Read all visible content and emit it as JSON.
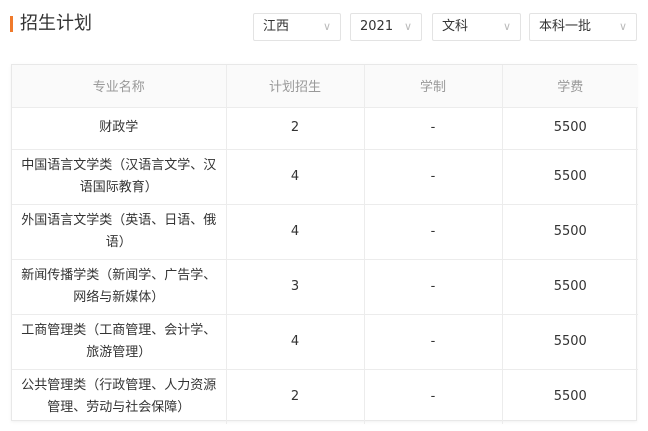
{
  "header": {
    "title": "招生计划"
  },
  "filters": {
    "province": "江西",
    "year": "2021",
    "subject": "文科",
    "batch": "本科一批",
    "chevron": "∨"
  },
  "table": {
    "columns": [
      "专业名称",
      "计划招生",
      "学制",
      "学费"
    ],
    "rows": [
      {
        "major": "财政学",
        "plan": "2",
        "duration": "-",
        "fee": "5500"
      },
      {
        "major": "中国语言文学类（汉语言文学、汉语国际教育）",
        "plan": "4",
        "duration": "-",
        "fee": "5500"
      },
      {
        "major": "外国语言文学类（英语、日语、俄语）",
        "plan": "4",
        "duration": "-",
        "fee": "5500"
      },
      {
        "major": "新闻传播学类（新闻学、广告学、网络与新媒体）",
        "plan": "3",
        "duration": "-",
        "fee": "5500"
      },
      {
        "major": "工商管理类（工商管理、会计学、旅游管理）",
        "plan": "4",
        "duration": "-",
        "fee": "5500"
      },
      {
        "major": "公共管理类（行政管理、人力资源管理、劳动与社会保障）",
        "plan": "2",
        "duration": "-",
        "fee": "5500"
      }
    ]
  }
}
